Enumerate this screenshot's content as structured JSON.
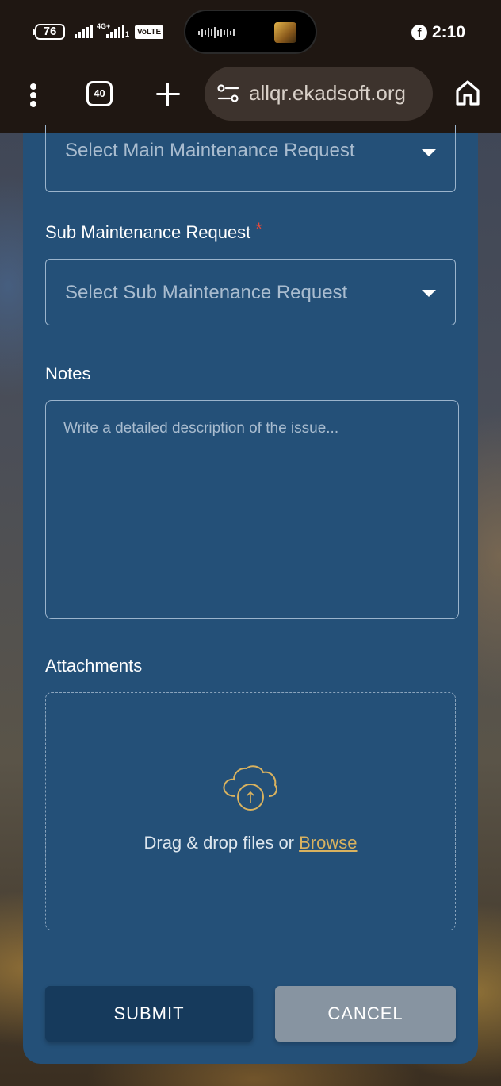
{
  "status_bar": {
    "battery_level": "76",
    "network_type": "4G+",
    "sim2_label": "1",
    "volte_label": "VoLTE",
    "notification_icon": "facebook-icon",
    "time": "2:10"
  },
  "browser": {
    "tab_count": "40",
    "url": "allqr.ekadsoft.org",
    "icons": [
      "menu-dots-icon",
      "tabs-icon",
      "plus-icon",
      "site-settings-icon",
      "home-icon"
    ]
  },
  "form": {
    "main_request": {
      "placeholder": "Select Main Maintenance Request"
    },
    "sub_request": {
      "label": "Sub Maintenance Request",
      "required_marker": "*",
      "placeholder": "Select Sub Maintenance Request"
    },
    "notes": {
      "label": "Notes",
      "placeholder": "Write a detailed description of the issue..."
    },
    "attachments": {
      "label": "Attachments",
      "drop_text": "Drag & drop files or",
      "browse_label": "Browse",
      "icon": "cloud-upload-icon"
    },
    "submit_label": "SUBMIT",
    "cancel_label": "CANCEL"
  },
  "colors": {
    "card_background": "#245078",
    "submit_button": "#163a5c",
    "cancel_button": "#8794a1",
    "required_star": "#e24a3c",
    "browse_link": "#d9b25f",
    "browser_chrome": "#1f1712"
  }
}
